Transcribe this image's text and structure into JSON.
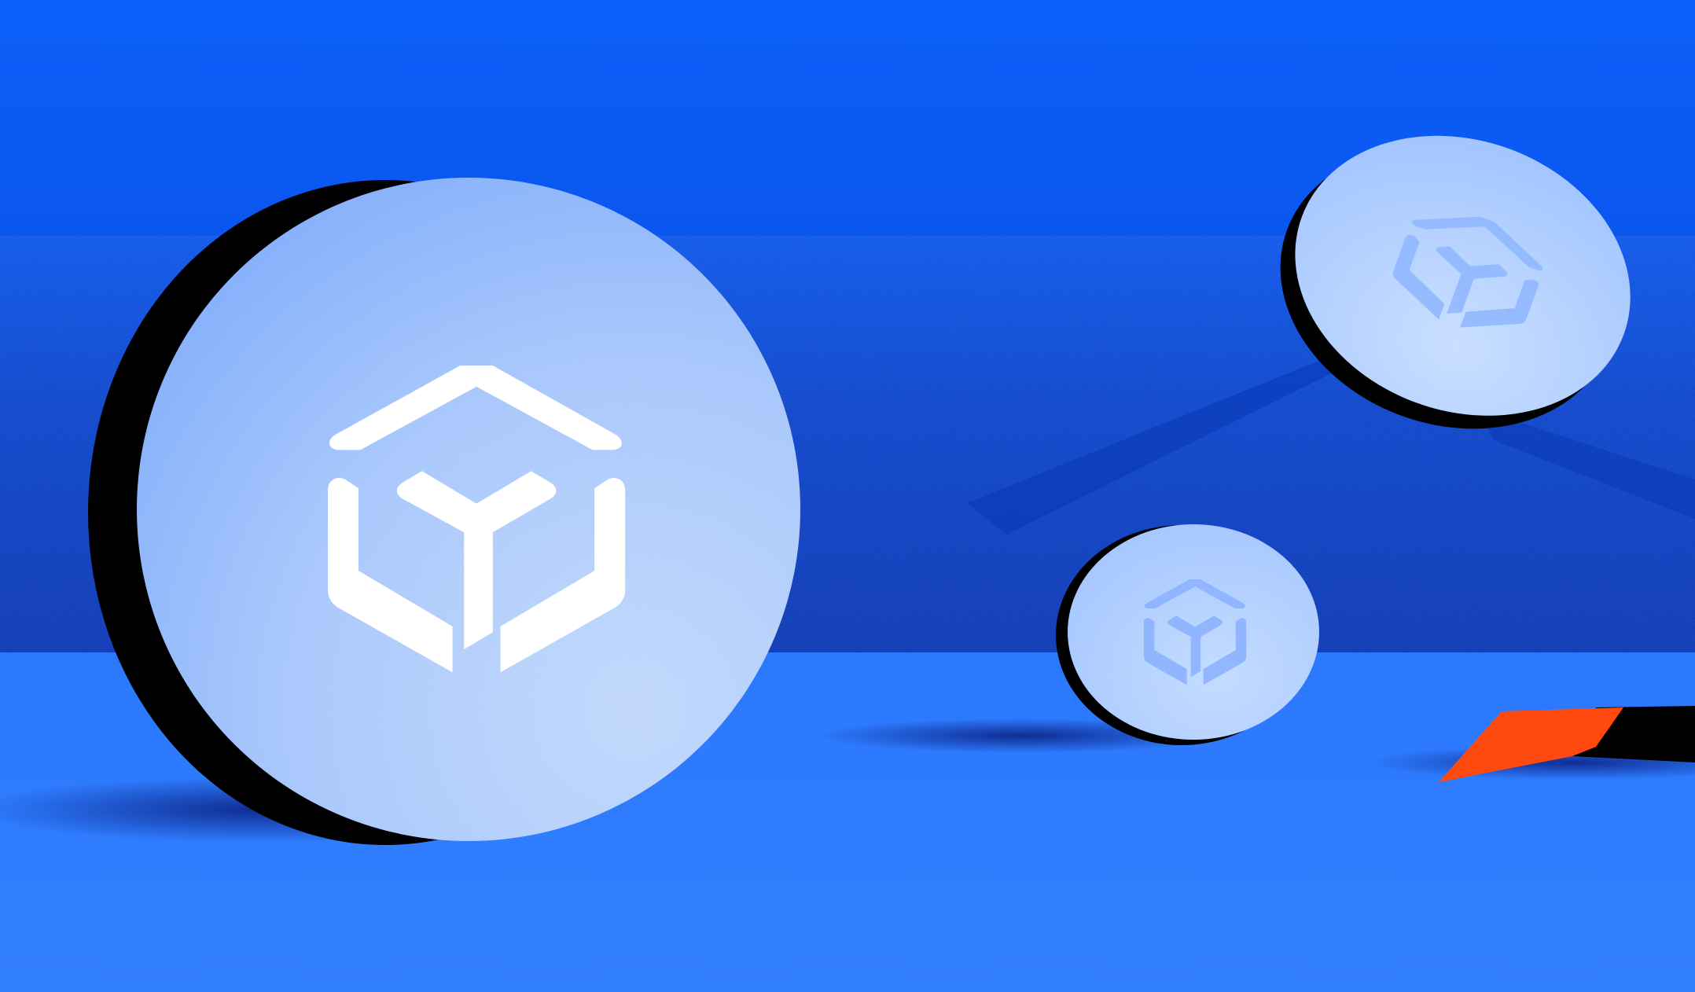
{
  "scene": {
    "colors": {
      "sky_top": "#0b5ff8",
      "sky_mid": "#0a4fe0",
      "sky_deep": "#0833b8",
      "floor": "#2f7dfe",
      "coin_face_light": "#bdd6ff",
      "coin_face_mid": "#8cb6ff",
      "coin_rim": "#000000",
      "logo_white": "#ffffff",
      "accent_orange": "#ff4a0f",
      "shadow": "#061a6b"
    },
    "coins": [
      {
        "name": "large-coin",
        "logo": "cube-y-logo-icon"
      },
      {
        "name": "floating-coin",
        "logo": "cube-y-logo-icon"
      },
      {
        "name": "small-coin",
        "logo": "cube-y-logo-icon"
      }
    ]
  }
}
